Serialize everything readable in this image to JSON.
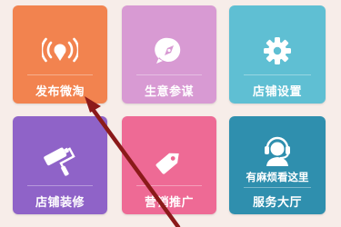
{
  "tiles": [
    {
      "label": "发布微淘",
      "icon": "broadcast-icon",
      "color": "#f2834f"
    },
    {
      "label": "生意参谋",
      "icon": "compass-bubble-icon",
      "color": "#d89ad3"
    },
    {
      "label": "店铺设置",
      "icon": "gear-icon",
      "color": "#5fbfd3"
    },
    {
      "label": "店铺装修",
      "icon": "paint-roller-icon",
      "color": "#8f63c8"
    },
    {
      "label": "营销推广",
      "icon": "price-tag-icon",
      "color": "#ee6a95"
    },
    {
      "label": "服务大厅",
      "icon": "headset-person-icon",
      "color": "#2f8fae",
      "hint": "有麻烦看这里"
    }
  ],
  "annotation": {
    "icon": "arrow-pointer-icon",
    "color": "#8b1a1a"
  }
}
